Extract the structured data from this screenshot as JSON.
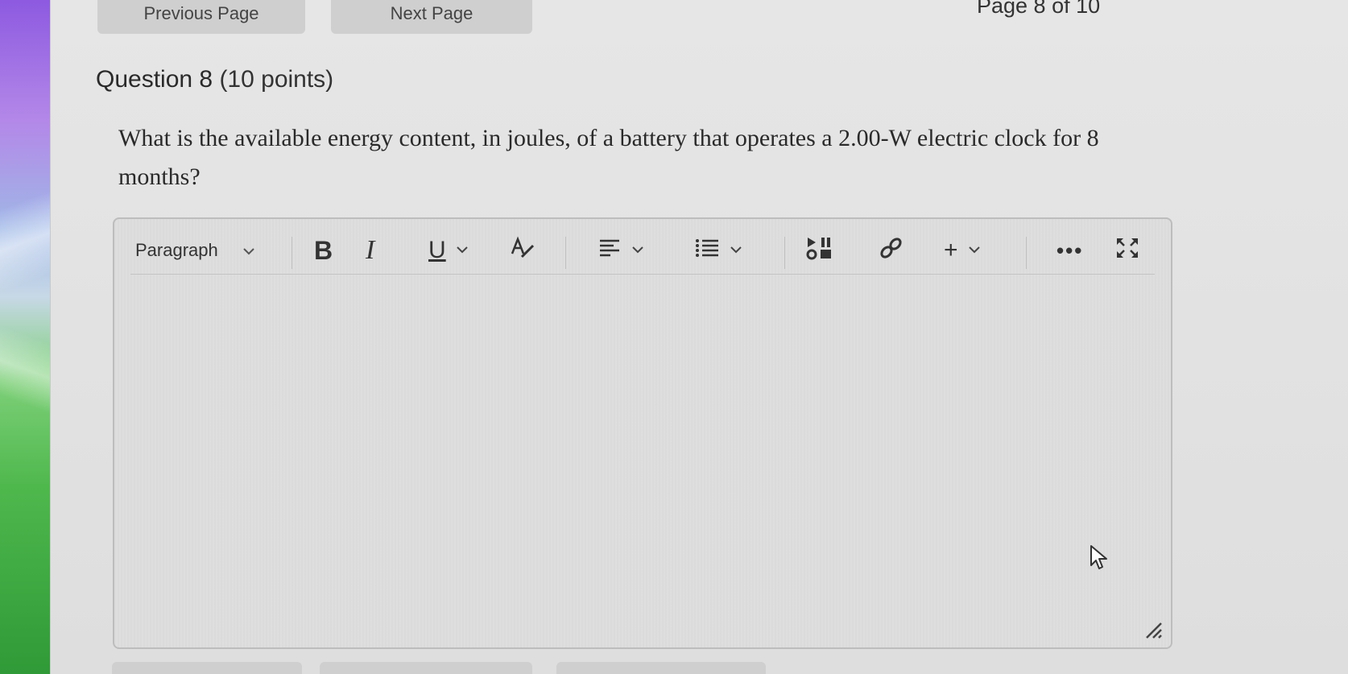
{
  "nav": {
    "previous_label": "Previous Page",
    "next_label": "Next Page",
    "page_counter": "Page 8 of 10"
  },
  "question": {
    "title": "Question 8",
    "points": "(10 points)",
    "text": "What is the available energy content, in joules, of a battery that operates a 2.00-W electric clock for 8 months?"
  },
  "editor": {
    "block_format": "Paragraph",
    "toolbar_icons": [
      "bold-icon",
      "italic-icon",
      "underline-icon",
      "format-icon",
      "align-icon",
      "list-icon",
      "media-icon",
      "link-icon",
      "insert-icon",
      "more-icon",
      "fullscreen-icon"
    ],
    "bold_glyph": "B",
    "italic_glyph": "I",
    "underline_glyph": "U",
    "insert_glyph": "+",
    "more_glyph": "•••",
    "content": ""
  }
}
